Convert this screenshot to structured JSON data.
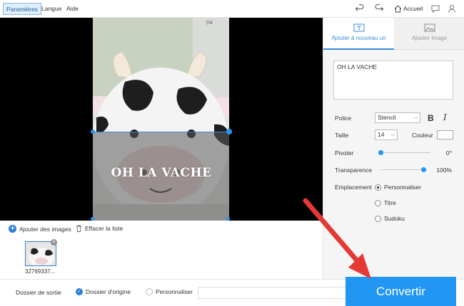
{
  "menu": {
    "settings": "Paramètres",
    "language": "Langue",
    "help": "Aide",
    "home": "Accueil"
  },
  "preview": {
    "watermark_text": "OH LA VACHE"
  },
  "image_list": {
    "add_images": "Ajouter des images",
    "clear_list": "Effacer la liste",
    "thumbnail_name": "32769337..."
  },
  "bottom": {
    "output_folder_label": "Dossier de sortie",
    "origin_folder": "Dossier d'origine",
    "customize": "Personnaliser",
    "convert": "Convertir"
  },
  "panel": {
    "tab_add_text": "Ajouter à nouveau un texte",
    "tab_add_image": "Ajouter image",
    "text_value": "OH LA VACHE",
    "font_label": "Police",
    "font_value": "Stencil",
    "bold": "B",
    "italic": "I",
    "size_label": "Taille",
    "size_value": "14",
    "color_label": "Couleur",
    "rotate_label": "Pivoter",
    "rotate_value": "0°",
    "rotate_fraction": 0.0,
    "transparency_label": "Transparence",
    "transparency_value": "100%",
    "transparency_fraction": 1.0,
    "location_label": "Emplacement",
    "location_options": [
      "Personnaliser",
      "Titre",
      "Sudoku"
    ],
    "location_selected": "Personnaliser"
  },
  "colors": {
    "accent": "#2196f3",
    "arrow": "#e53935"
  },
  "icons": [
    "undo-icon",
    "redo-icon",
    "home-icon",
    "chat-icon",
    "user-icon",
    "text-tab-icon",
    "image-tab-icon",
    "plus-icon",
    "trash-icon",
    "check-icon",
    "close-icon"
  ]
}
